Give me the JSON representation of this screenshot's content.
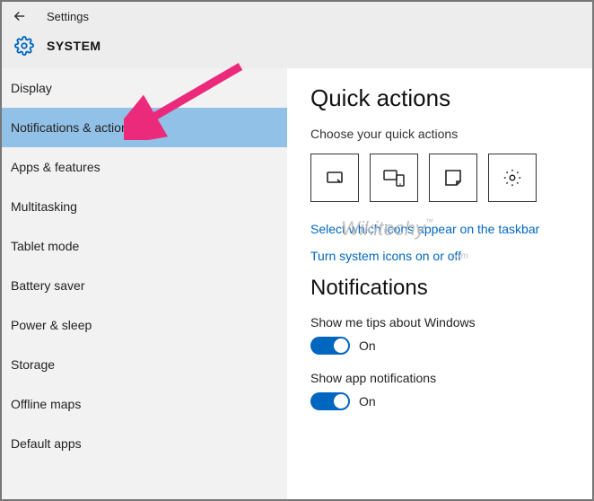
{
  "header": {
    "app_title": "Settings",
    "section": "SYSTEM"
  },
  "sidebar": {
    "items": [
      {
        "label": "Display"
      },
      {
        "label": "Notifications & actions"
      },
      {
        "label": "Apps & features"
      },
      {
        "label": "Multitasking"
      },
      {
        "label": "Tablet mode"
      },
      {
        "label": "Battery saver"
      },
      {
        "label": "Power & sleep"
      },
      {
        "label": "Storage"
      },
      {
        "label": "Offline maps"
      },
      {
        "label": "Default apps"
      }
    ],
    "selected_index": 1
  },
  "content": {
    "quick_actions_heading": "Quick actions",
    "quick_actions_sub": "Choose your quick actions",
    "tiles": [
      "tablet-mode-icon",
      "connect-icon",
      "note-icon",
      "settings-icon"
    ],
    "link_taskbar": "Select which icons appear on the taskbar",
    "link_sysicons": "Turn system icons on or off",
    "notifications_heading": "Notifications",
    "tips": {
      "label": "Show me tips about Windows",
      "state": "On"
    },
    "appnotif": {
      "label": "Show app notifications",
      "state": "On"
    }
  },
  "watermark": "Wikitechy",
  "watermark_sub": ".com"
}
